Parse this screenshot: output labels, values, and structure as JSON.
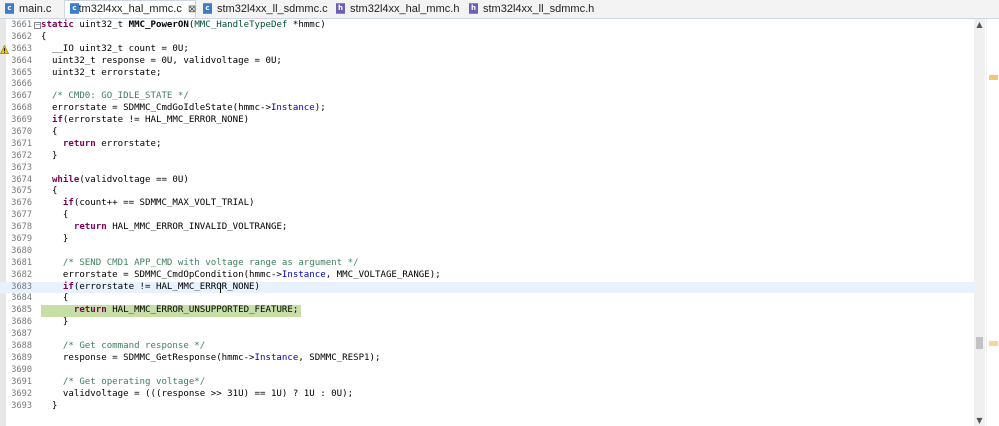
{
  "tabs": [
    {
      "label": "main.c",
      "type": "c",
      "active": false
    },
    {
      "label": "stm32l4xx_hal_mmc.c",
      "type": "c",
      "active": true,
      "close": "⊠"
    },
    {
      "label": "stm32l4xx_ll_sdmmc.c",
      "type": "c",
      "active": false
    },
    {
      "label": "stm32l4xx_hal_mmc.h",
      "type": "h",
      "active": false
    },
    {
      "label": "stm32l4xx_ll_sdmmc.h",
      "type": "h",
      "active": false
    }
  ],
  "icons": {
    "file_c": "c-file-icon",
    "file_h": "h-file-icon",
    "fold": "fold-toggle-icon",
    "warning": "warning-icon"
  },
  "colors": {
    "keyword": "#7f0055",
    "comment": "#3f7f5f",
    "field": "#0000c0",
    "highlight": "#c7dfa6",
    "current_line": "#e8f2fe"
  },
  "editor": {
    "lines": [
      {
        "n": "3661",
        "html": "<span class=\"kw\">static</span> uint32_t <span class=\"fn\">MMC_PowerON</span>(<span class=\"typ\">MMC_HandleTypeDef</span> *hmmc)",
        "fold": "−"
      },
      {
        "n": "3662",
        "html": "{"
      },
      {
        "n": "3663",
        "html": "  __IO uint32_t count = 0U;",
        "warn": true
      },
      {
        "n": "3664",
        "html": "  uint32_t response = 0U, validvoltage = 0U;"
      },
      {
        "n": "3665",
        "html": "  uint32_t errorstate;"
      },
      {
        "n": "3666",
        "html": ""
      },
      {
        "n": "3667",
        "html": "  <span class=\"cm\">/* CMD0: GO_IDLE_STATE */</span>"
      },
      {
        "n": "3668",
        "html": "  errorstate = SDMMC_CmdGoIdleState(hmmc-&gt;<span class=\"fld\">Instance</span>);"
      },
      {
        "n": "3669",
        "html": "  <span class=\"kw\">if</span>(errorstate != HAL_MMC_ERROR_NONE)"
      },
      {
        "n": "3670",
        "html": "  {"
      },
      {
        "n": "3671",
        "html": "    <span class=\"kw\">return</span> errorstate;"
      },
      {
        "n": "3672",
        "html": "  }"
      },
      {
        "n": "3673",
        "html": ""
      },
      {
        "n": "3674",
        "html": "  <span class=\"kw\">while</span>(validvoltage == 0U)"
      },
      {
        "n": "3675",
        "html": "  {"
      },
      {
        "n": "3676",
        "html": "    <span class=\"kw\">if</span>(count++ == SDMMC_MAX_VOLT_TRIAL)"
      },
      {
        "n": "3677",
        "html": "    {"
      },
      {
        "n": "3678",
        "html": "      <span class=\"kw\">return</span> HAL_MMC_ERROR_INVALID_VOLTRANGE;"
      },
      {
        "n": "3679",
        "html": "    }"
      },
      {
        "n": "3680",
        "html": ""
      },
      {
        "n": "3681",
        "html": "    <span class=\"cm\">/* SEND CMD1 APP_CMD with voltage range as argument */</span>"
      },
      {
        "n": "3682",
        "html": "    errorstate = SDMMC_CmdOpCondition(hmmc-&gt;<span class=\"fld\">Instance</span>, MMC_VOLTAGE_RANGE);"
      },
      {
        "n": "3683",
        "html": "    <span class=\"kw\">if</span>(errorstate != HAL_MMC_ERROR_NONE)",
        "current": true
      },
      {
        "n": "3684",
        "html": "    {"
      },
      {
        "n": "3685",
        "html": "      <span class=\"kw\">return</span> HAL_MMC_ERROR_UNSUPPORTED_FEATURE;",
        "highlight": true
      },
      {
        "n": "3686",
        "html": "    }"
      },
      {
        "n": "3687",
        "html": ""
      },
      {
        "n": "3688",
        "html": "    <span class=\"cm\">/* Get command response */</span>"
      },
      {
        "n": "3689",
        "html": "    response = SDMMC_GetResponse(hmmc-&gt;<span class=\"fld\">Instance</span>, SDMMC_RESP1);"
      },
      {
        "n": "3690",
        "html": ""
      },
      {
        "n": "3691",
        "html": "    <span class=\"cm\">/* Get operating voltage*/</span>"
      },
      {
        "n": "3692",
        "html": "    validvoltage = (((response &gt;&gt; 31U) == 1U) ? 1U : 0U);"
      },
      {
        "n": "3693",
        "html": "  }"
      }
    ]
  }
}
